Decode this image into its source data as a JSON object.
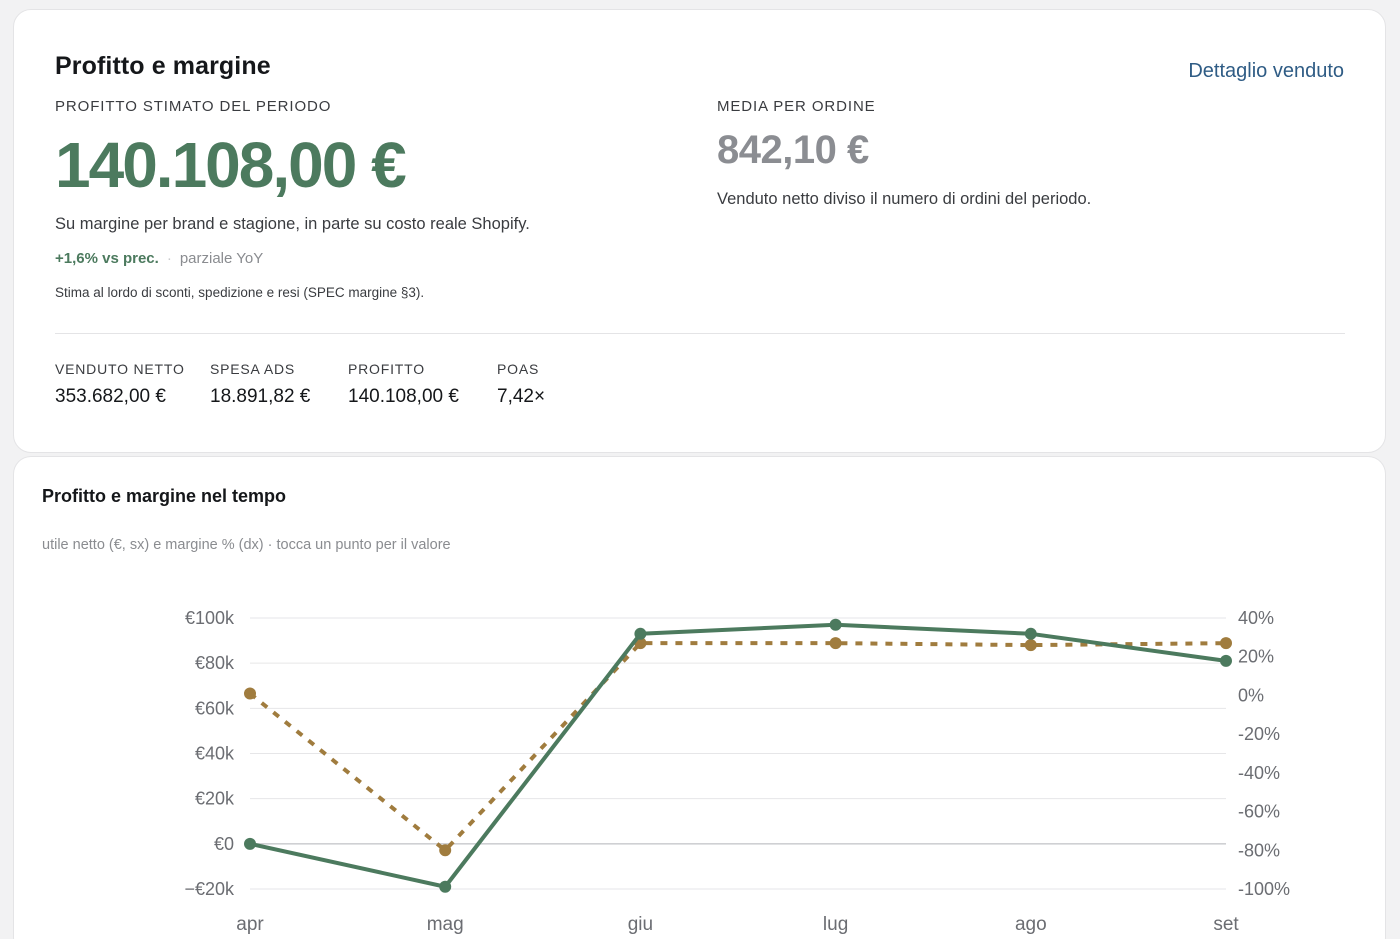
{
  "summary": {
    "title": "Profitto e margine",
    "detail_link": "Dettaglio venduto",
    "profit_label": "PROFITTO STIMATO DEL PERIODO",
    "profit_value": "140.108,00 €",
    "profit_description": "Su margine per brand e stagione, in parte su costo reale Shopify.",
    "delta_value": "+1,6% vs prec.",
    "delta_separator": "·",
    "delta_note": "parziale YoY",
    "footnote": "Stima al lordo di sconti, spedizione e resi (SPEC margine §3).",
    "aov_label": "MEDIA PER ORDINE",
    "aov_value": "842,10 €",
    "aov_description": "Venduto netto diviso il numero di ordini del periodo.",
    "kpis": [
      {
        "label": "VENDUTO NETTO",
        "value": "353.682,00 €"
      },
      {
        "label": "SPESA ADS",
        "value": "18.891,82 €"
      },
      {
        "label": "PROFITTO",
        "value": "140.108,00 €"
      },
      {
        "label": "POAS",
        "value": "7,42×"
      }
    ],
    "colors": {
      "profit_green": "#4c7a5e",
      "link_blue": "#2f5c85",
      "muted_grey": "#8b8d92"
    }
  },
  "chart": {
    "title": "Profitto e margine nel tempo",
    "subtitle": "utile netto (€, sx) e margine % (dx) · tocca un punto per il valore"
  },
  "chart_data": {
    "type": "line",
    "categories": [
      "apr",
      "mag",
      "giu",
      "lug",
      "ago",
      "set"
    ],
    "y_left": {
      "ticks": [
        -20000,
        0,
        20000,
        40000,
        60000,
        80000,
        100000
      ],
      "tick_labels": [
        "−€20k",
        "€0",
        "€20k",
        "€40k",
        "€60k",
        "€80k",
        "€100k"
      ],
      "lim": [
        -20000,
        100000
      ]
    },
    "y_right": {
      "ticks": [
        -100,
        -80,
        -60,
        -40,
        -20,
        0,
        20,
        40
      ],
      "tick_labels": [
        "-100%",
        "-80%",
        "-60%",
        "-40%",
        "-20%",
        "0%",
        "20%",
        "40%"
      ],
      "lim": [
        -100,
        40
      ]
    },
    "series": [
      {
        "axis": "left",
        "style": "solid",
        "color": "#4c7a5e",
        "values": [
          0,
          -19000,
          93000,
          97000,
          93000,
          81000
        ]
      },
      {
        "axis": "right",
        "style": "dashed",
        "color": "#a07c3e",
        "values": [
          1,
          -80,
          27,
          27,
          26,
          27
        ]
      }
    ],
    "grid": true,
    "legend": "none"
  }
}
